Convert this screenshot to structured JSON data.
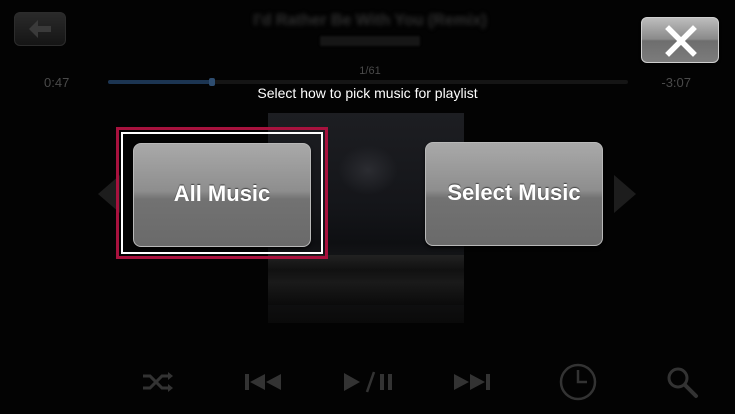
{
  "player": {
    "track_title": "I'd Rather Be With You (Remix)",
    "track_count": "1/61",
    "elapsed": "0:47",
    "remaining": "-3:07",
    "progress_fraction": 0.2,
    "icons": {
      "back": "back-arrow-icon",
      "shuffle": "shuffle-icon",
      "previous": "previous-track-icon",
      "play_pause": "play-pause-icon",
      "next": "next-track-icon",
      "timer": "clock-icon",
      "search": "search-icon"
    }
  },
  "dialog": {
    "prompt": "Select how to pick music for playlist",
    "options": [
      {
        "label": "All Music",
        "selected": true
      },
      {
        "label": "Select Music",
        "selected": false
      }
    ],
    "close_icon": "close-x-icon"
  },
  "colors": {
    "highlight": "#a8123e",
    "button_gray": "#8e8e8e",
    "progress": "#1c3552"
  }
}
